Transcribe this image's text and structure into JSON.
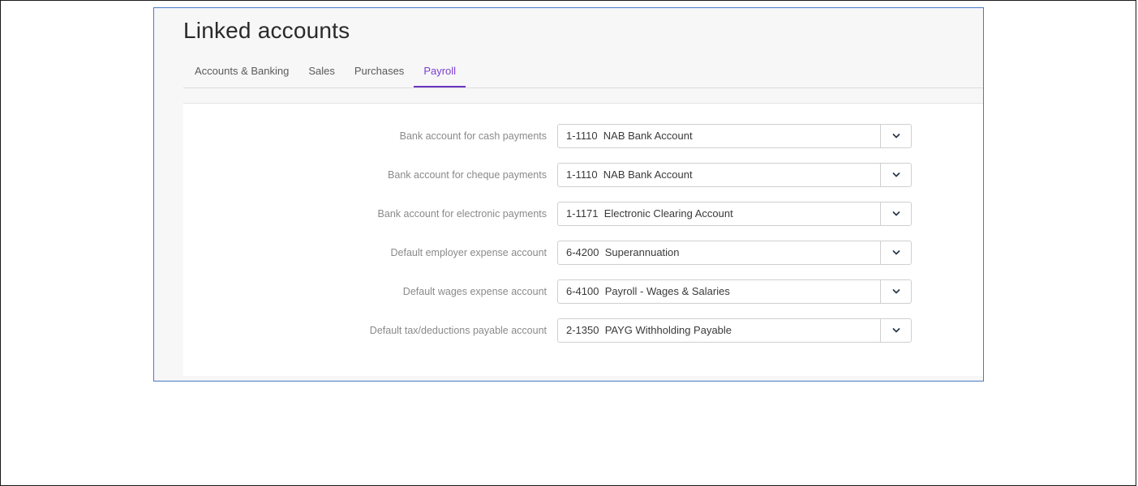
{
  "page": {
    "title": "Linked accounts"
  },
  "tabs": [
    {
      "label": "Accounts & Banking",
      "active": false
    },
    {
      "label": "Sales",
      "active": false
    },
    {
      "label": "Purchases",
      "active": false
    },
    {
      "label": "Payroll",
      "active": true
    }
  ],
  "form": {
    "rows": [
      {
        "label": "Bank account for cash payments",
        "value": "1-1110  NAB Bank Account"
      },
      {
        "label": "Bank account for cheque payments",
        "value": "1-1110  NAB Bank Account"
      },
      {
        "label": "Bank account for electronic payments",
        "value": "1-1171  Electronic Clearing Account"
      },
      {
        "label": "Default employer expense account",
        "value": "6-4200  Superannuation"
      },
      {
        "label": "Default wages expense account",
        "value": "6-4100  Payroll - Wages & Salaries"
      },
      {
        "label": "Default tax/deductions payable account",
        "value": "2-1350  PAYG Withholding Payable"
      }
    ]
  },
  "icons": {
    "dropdown": "chevron-down-icon"
  },
  "colors": {
    "active_tab": "#7b3fd0",
    "window_border": "#4a78c8"
  }
}
